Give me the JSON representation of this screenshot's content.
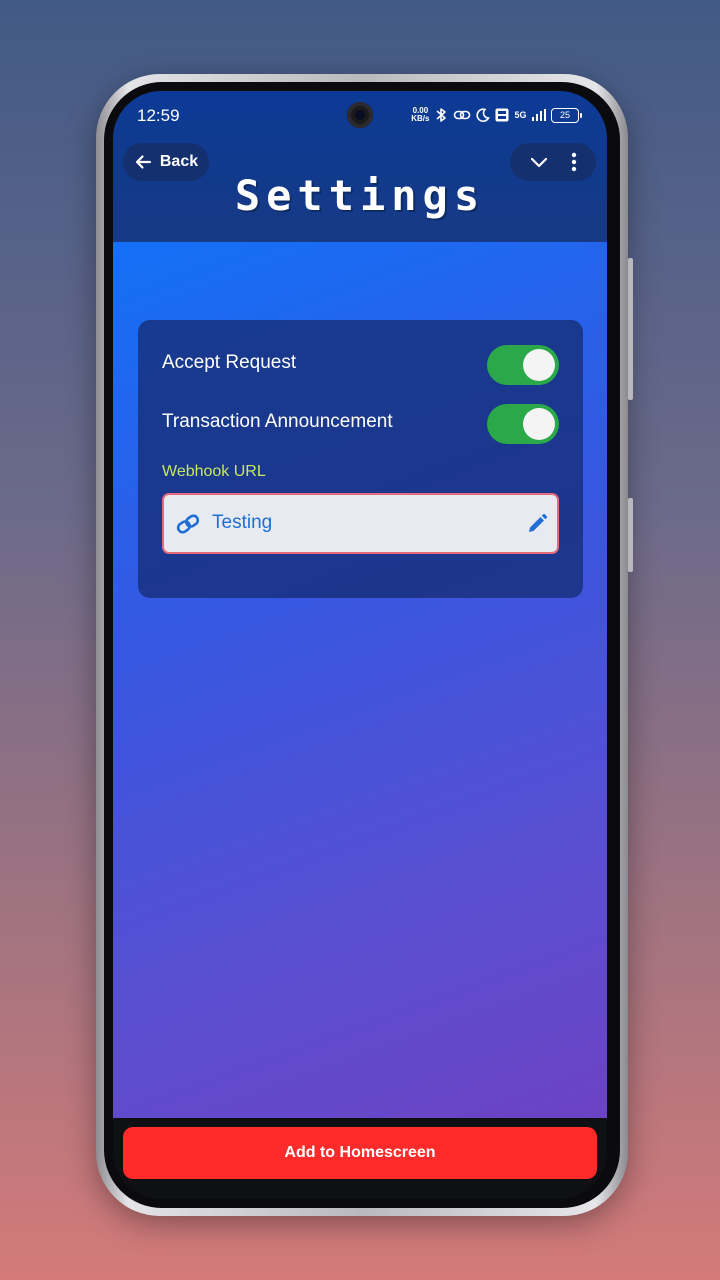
{
  "status_bar": {
    "time": "12:59",
    "net_speed_value": "0.00",
    "net_speed_unit": "KB/s",
    "network": "5G",
    "battery": "25"
  },
  "header": {
    "back_label": "Back",
    "title": "Settings"
  },
  "settings": {
    "accept_request": {
      "label": "Accept Request",
      "enabled": true
    },
    "transaction_announcement": {
      "label": "Transaction Announcement",
      "enabled": true
    },
    "webhook_label": "Webhook URL",
    "webhook_value": "Testing"
  },
  "footer": {
    "add_home_label": "Add to Homescreen"
  },
  "colors": {
    "toggle_on": "#2aa84a",
    "primary_button": "#ff2a2a",
    "webhook_label": "#c6e85b",
    "link_text": "#1f6ed6"
  },
  "icons": [
    "back-arrow-icon",
    "chevron-down-icon",
    "more-vert-icon",
    "bluetooth-icon",
    "link-icon",
    "moon-icon",
    "volte-icon",
    "signal-icon",
    "battery-icon",
    "edit-pencil-icon"
  ]
}
